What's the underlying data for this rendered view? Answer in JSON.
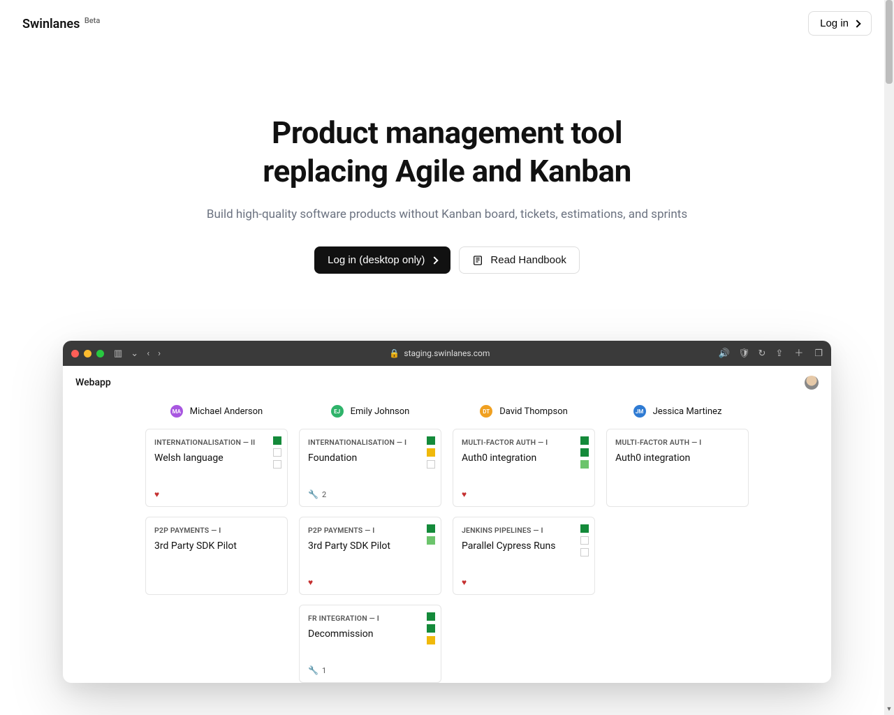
{
  "brand": {
    "name": "Swinlanes",
    "badge": "Beta"
  },
  "header": {
    "login": "Log in"
  },
  "hero": {
    "title_l1": "Product management tool",
    "title_l2": "replacing Agile and Kanban",
    "subtitle": "Build high-quality software products without Kanban board, tickets, estimations, and sprints",
    "cta_primary": "Log in (desktop only)",
    "cta_secondary": "Read Handbook"
  },
  "mock": {
    "url": "staging.swinlanes.com",
    "app_title": "Webapp",
    "columns": [
      {
        "avatar": {
          "initials": "MA",
          "bg": "#a857e0"
        },
        "name": "Michael Anderson",
        "cards": [
          {
            "label": "INTERNATIONALISATION — II",
            "title": "Welsh language",
            "status": [
              "g",
              "e",
              "e"
            ],
            "foot": {
              "icon": "heart",
              "text": ""
            }
          },
          {
            "label": "P2P PAYMENTS — I",
            "title": "3rd Party SDK Pilot",
            "status": [],
            "foot": null
          }
        ]
      },
      {
        "avatar": {
          "initials": "EJ",
          "bg": "#2fb36a"
        },
        "name": "Emily Johnson",
        "cards": [
          {
            "label": "INTERNATIONALISATION — I",
            "title": "Foundation",
            "status": [
              "g",
              "y",
              "e"
            ],
            "foot": {
              "icon": "wrench",
              "text": "2"
            }
          },
          {
            "label": "P2P PAYMENTS — I",
            "title": "3rd Party SDK Pilot",
            "status": [
              "g",
              "lg"
            ],
            "foot": {
              "icon": "heart",
              "text": ""
            }
          },
          {
            "label": "FR INTEGRATION — I",
            "title": "Decommission",
            "status": [
              "g",
              "g",
              "y"
            ],
            "foot": {
              "icon": "wrench",
              "text": "1"
            }
          }
        ]
      },
      {
        "avatar": {
          "initials": "DT",
          "bg": "#f0a020"
        },
        "name": "David Thompson",
        "cards": [
          {
            "label": "MULTI-FACTOR AUTH — I",
            "title": "Auth0 integration",
            "status": [
              "g",
              "g",
              "lg"
            ],
            "foot": {
              "icon": "heart",
              "text": ""
            }
          },
          {
            "label": "JENKINS PIPELINES — I",
            "title": "Parallel Cypress Runs",
            "status": [
              "g",
              "e",
              "e"
            ],
            "foot": {
              "icon": "heart",
              "text": ""
            }
          }
        ]
      },
      {
        "avatar": {
          "initials": "JM",
          "bg": "#2f7bd3"
        },
        "name": "Jessica Martinez",
        "cards": [
          {
            "label": "MULTI-FACTOR AUTH — I",
            "title": "Auth0 integration",
            "status": [],
            "foot": null
          }
        ]
      }
    ]
  }
}
